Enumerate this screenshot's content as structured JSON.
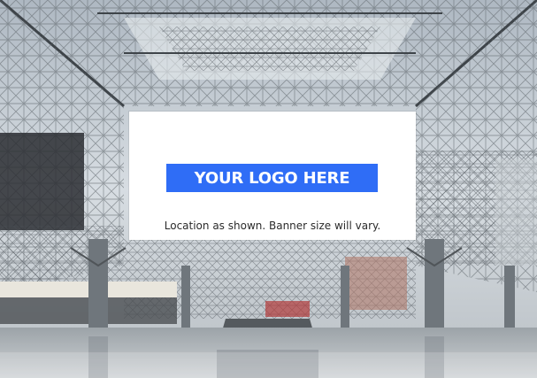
{
  "banner": {
    "logo_text": "YOUR LOGO HERE",
    "caption": "Location as shown. Banner size will vary.",
    "logo_background": "#2f6df6"
  },
  "scene": {
    "description_icon": "glass-atrium-photo"
  }
}
